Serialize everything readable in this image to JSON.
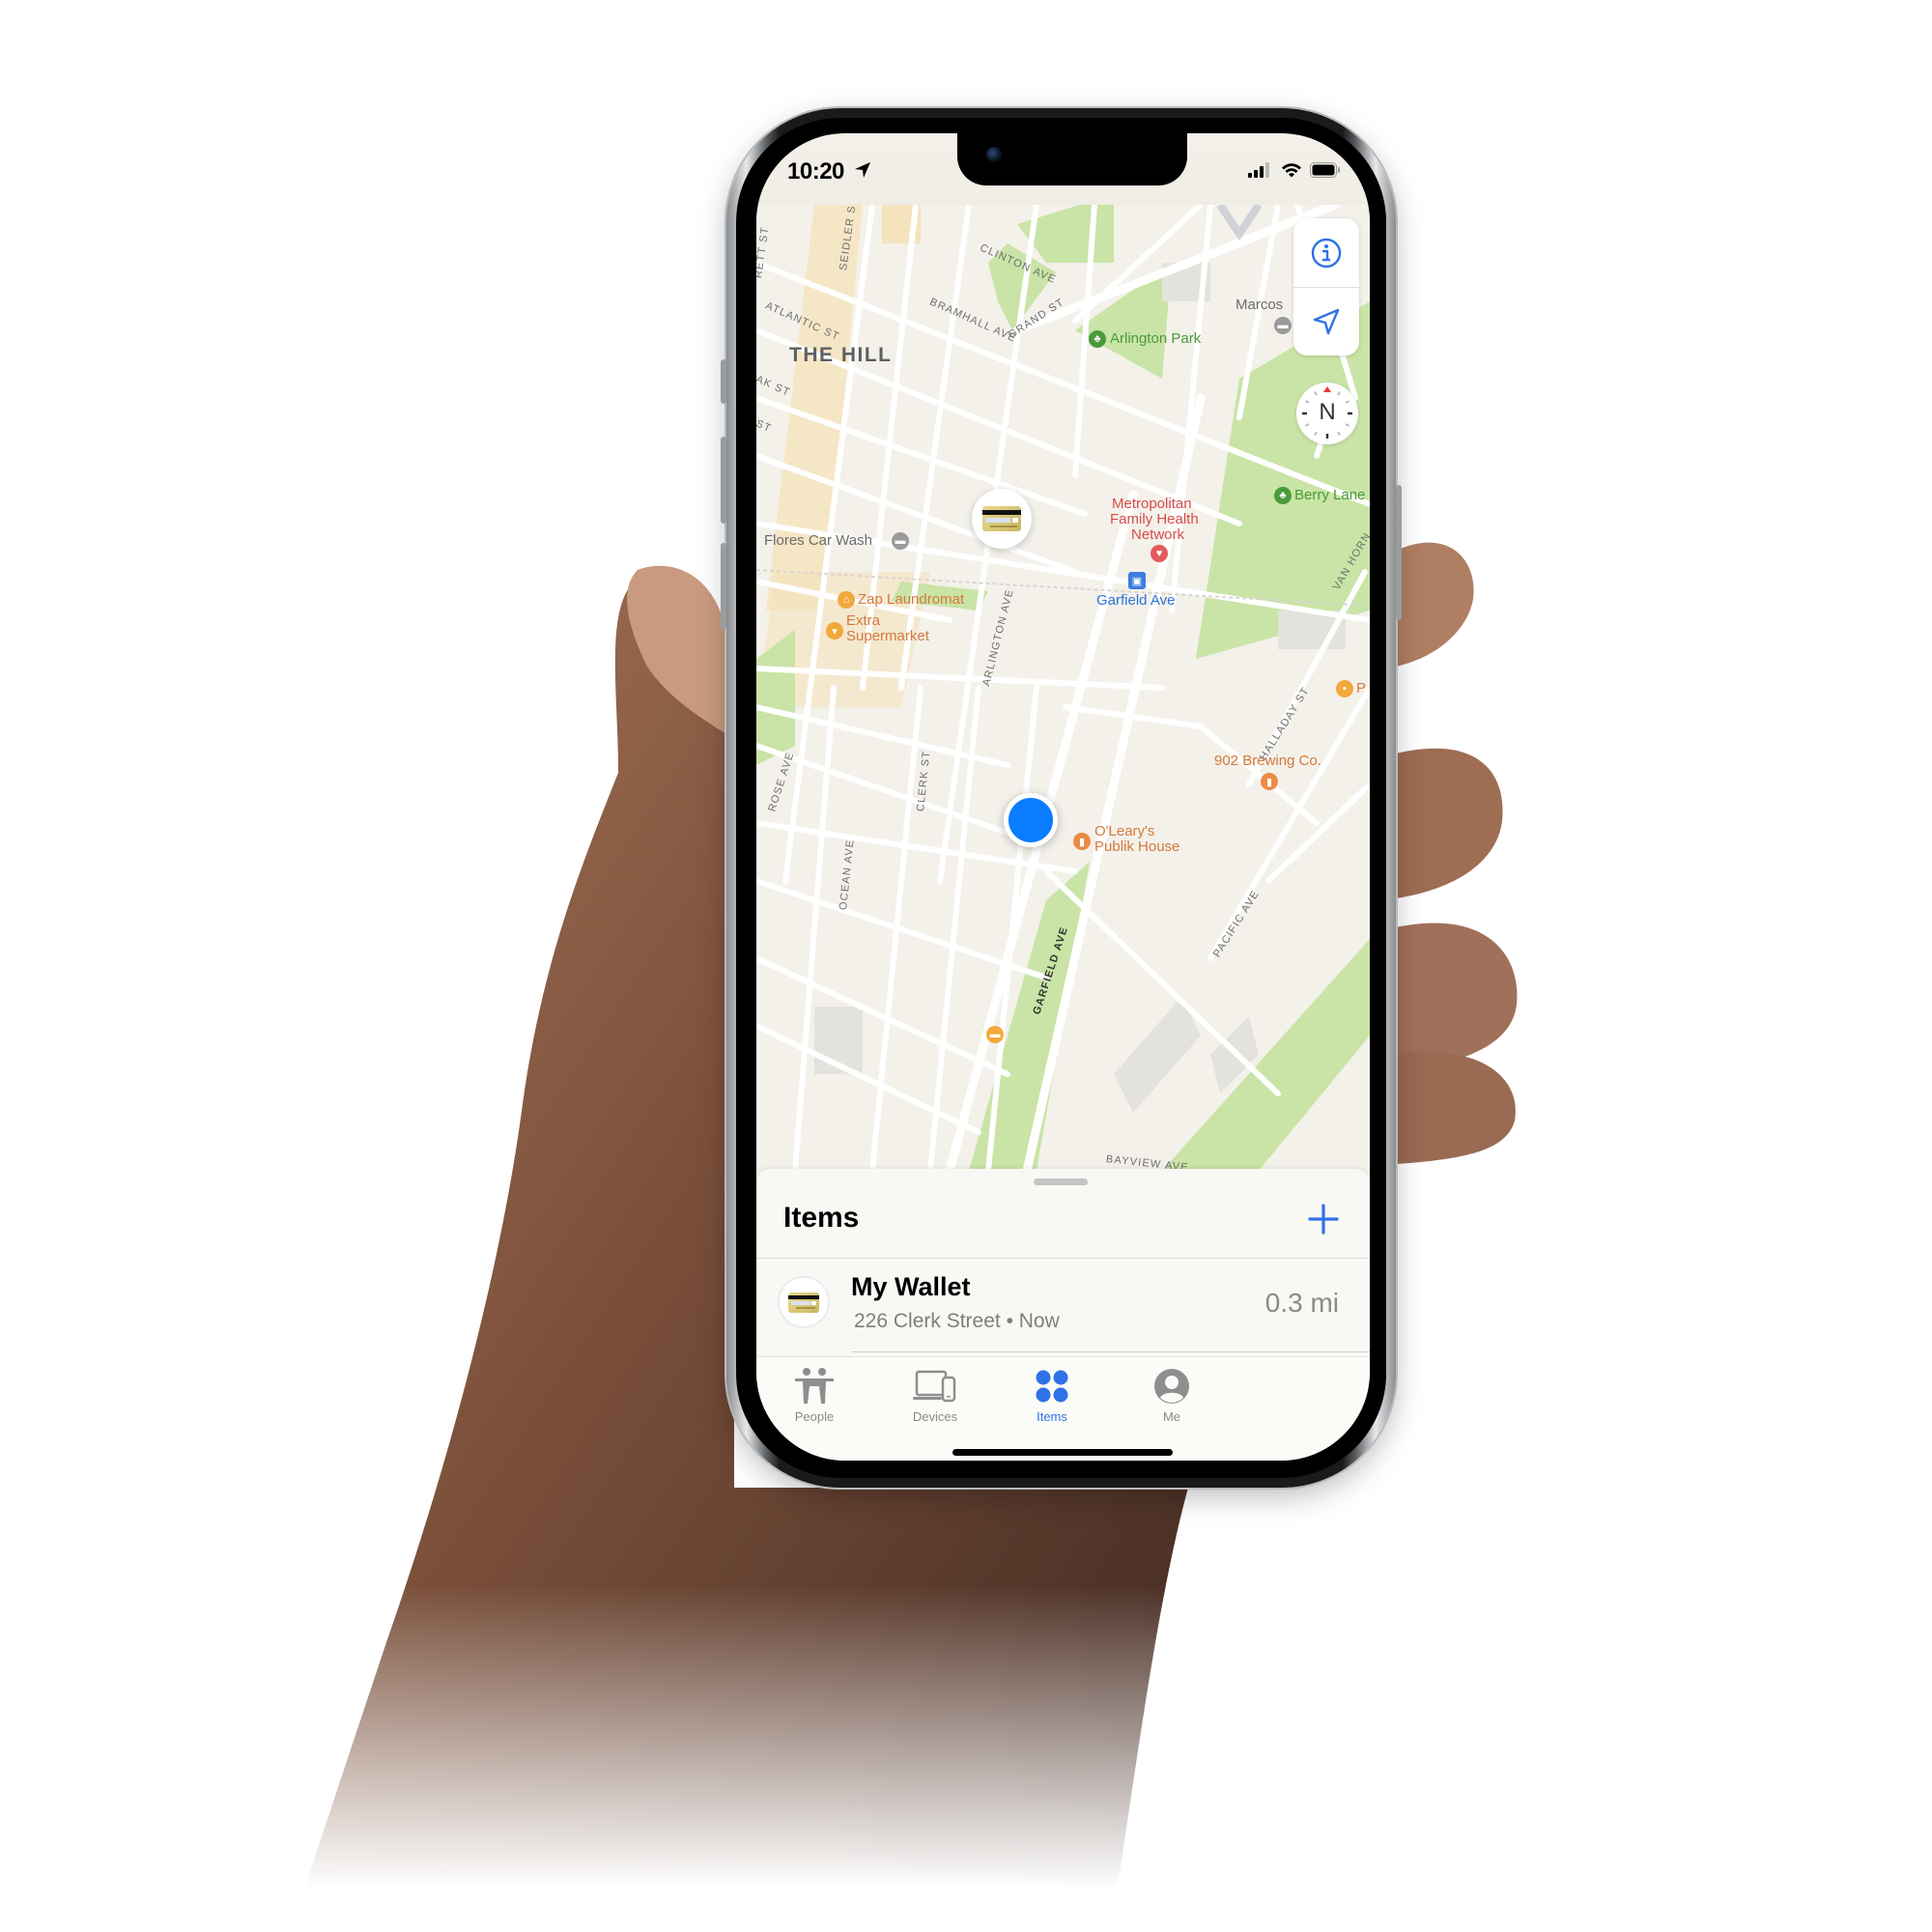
{
  "status_bar": {
    "time": "10:20",
    "icons": [
      "location-arrow-icon",
      "cellular-signal-icon",
      "wifi-icon",
      "battery-icon"
    ]
  },
  "map": {
    "district": "THE HILL",
    "streets": [
      "SEIDLER ST",
      "CLINTON AVE",
      "ATLANTIC ST",
      "BRAMHALL AVE",
      "GRAND ST",
      "AK ST",
      "ST",
      "RETT ST",
      "ARLINGTON AVE",
      "ROSE AVE",
      "CLERK ST",
      "OCEAN AVE",
      "GARFIELD AVE",
      "HALLADAY ST",
      "PACIFIC AVE",
      "VAN HORN",
      "BAYVIEW AVE"
    ],
    "pois": [
      {
        "name": "Arlington Park",
        "category": "park",
        "icon": "tree-icon",
        "color": "#4a9a3a"
      },
      {
        "name": "Marcos",
        "category": "car-service",
        "icon": "car-icon",
        "color": "#6b6b6b"
      },
      {
        "name": "Berry Lane",
        "category": "park",
        "icon": "tree-icon",
        "color": "#4a9a3a"
      },
      {
        "name": "Flores Car Wash",
        "category": "car-wash",
        "icon": "car-wash-icon",
        "color": "#6b6b6b"
      },
      {
        "name": "Metropolitan Family Health Network",
        "lines": [
          "Metropolitan",
          "Family Health",
          "Network"
        ],
        "category": "medical",
        "icon": "stethoscope-icon",
        "color": "#d64b4b"
      },
      {
        "name": "Garfield Ave",
        "category": "transit",
        "icon": "tram-icon",
        "color": "#2f72d6"
      },
      {
        "name": "Zap Laundromat",
        "category": "laundry",
        "icon": "hanger-icon",
        "color": "#d4793a"
      },
      {
        "name": "Extra Supermarket",
        "lines": [
          "Extra",
          "Supermarket"
        ],
        "category": "grocery",
        "icon": "cart-icon",
        "color": "#d4793a"
      },
      {
        "name": "902 Brewing Co.",
        "category": "brewery",
        "icon": "beer-icon",
        "color": "#d4793a"
      },
      {
        "name": "O'Leary's Publik House",
        "lines": [
          "O'Leary's",
          "Publik House"
        ],
        "category": "pub",
        "icon": "beer-icon",
        "color": "#d4793a"
      },
      {
        "name": "P",
        "category": "shopping",
        "icon": "bag-icon",
        "color": "#d4793a"
      }
    ],
    "controls": {
      "info_icon": "info-icon",
      "locate_icon": "location-arrow-icon",
      "compass_label": "N"
    }
  },
  "sheet": {
    "title": "Items",
    "add_icon": "plus-icon",
    "items": [
      {
        "name": "My Wallet",
        "address": "226 Clerk Street",
        "separator": "•",
        "time": "Now",
        "subtitle": "226 Clerk Street • Now",
        "distance": "0.3 mi",
        "icon": "wallet-card-icon"
      }
    ]
  },
  "tabs": [
    {
      "label": "People",
      "icon": "people-icon",
      "active": false
    },
    {
      "label": "Devices",
      "icon": "devices-icon",
      "active": false
    },
    {
      "label": "Items",
      "icon": "items-icon",
      "active": true
    },
    {
      "label": "Me",
      "icon": "person-circle-icon",
      "active": false
    }
  ],
  "colors": {
    "accent": "#2f72e6",
    "user_location": "#0a7cff",
    "park": "#c9e4a6",
    "map_background": "#f3f1ea",
    "commercial": "#f5e3bd"
  }
}
